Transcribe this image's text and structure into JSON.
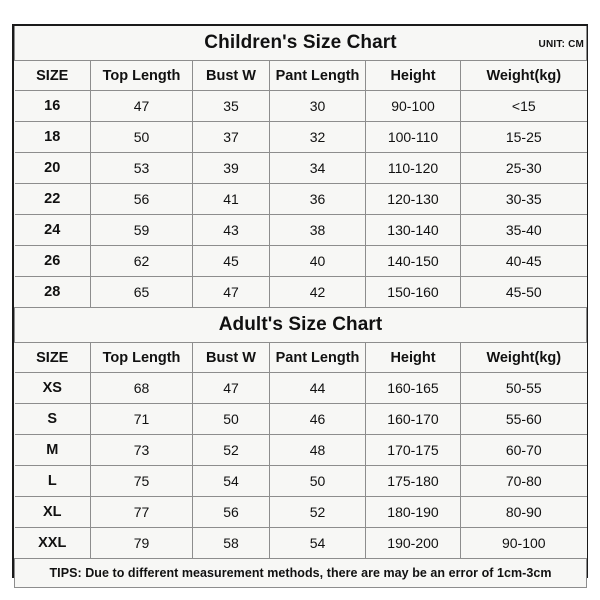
{
  "colors": {
    "header_blue": "#0caee8",
    "cell_background": "#f7f7f5",
    "border_outer": "#1a1a1a",
    "border_inner": "#8d8d8d",
    "text": "#111111",
    "tips_red": "#ee1c1c"
  },
  "children_chart": {
    "title": "Children's Size Chart",
    "unit": "UNIT: CM",
    "columns": [
      "SIZE",
      "Top Length",
      "Bust W",
      "Pant Length",
      "Height",
      "Weight(kg)"
    ],
    "rows": [
      [
        "16",
        "47",
        "35",
        "30",
        "90-100",
        "<15"
      ],
      [
        "18",
        "50",
        "37",
        "32",
        "100-110",
        "15-25"
      ],
      [
        "20",
        "53",
        "39",
        "34",
        "110-120",
        "25-30"
      ],
      [
        "22",
        "56",
        "41",
        "36",
        "120-130",
        "30-35"
      ],
      [
        "24",
        "59",
        "43",
        "38",
        "130-140",
        "35-40"
      ],
      [
        "26",
        "62",
        "45",
        "40",
        "140-150",
        "40-45"
      ],
      [
        "28",
        "65",
        "47",
        "42",
        "150-160",
        "45-50"
      ]
    ]
  },
  "adult_chart": {
    "title": "Adult's Size Chart",
    "columns": [
      "SIZE",
      "Top Length",
      "Bust W",
      "Pant Length",
      "Height",
      "Weight(kg)"
    ],
    "rows": [
      [
        "XS",
        "68",
        "47",
        "44",
        "160-165",
        "50-55"
      ],
      [
        "S",
        "71",
        "50",
        "46",
        "160-170",
        "55-60"
      ],
      [
        "M",
        "73",
        "52",
        "48",
        "170-175",
        "60-70"
      ],
      [
        "L",
        "75",
        "54",
        "50",
        "175-180",
        "70-80"
      ],
      [
        "XL",
        "77",
        "56",
        "52",
        "180-190",
        "80-90"
      ],
      [
        "XXL",
        "79",
        "58",
        "54",
        "190-200",
        "90-100"
      ]
    ]
  },
  "tips": "TIPS: Due to different measurement methods, there are may be an error of 1cm-3cm"
}
